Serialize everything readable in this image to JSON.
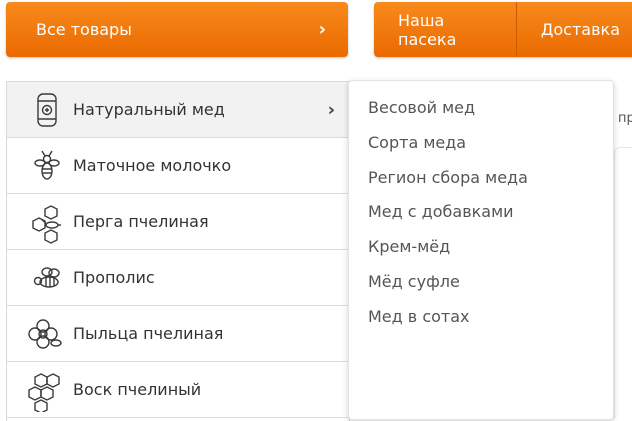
{
  "header": {
    "all_products_label": "Все товары",
    "all_products_chevron": "›",
    "nav": [
      {
        "label": "Наша пасека"
      },
      {
        "label": "Доставка"
      }
    ]
  },
  "categories": [
    {
      "label": "Натуральный мед",
      "icon": "honey-barrel-icon",
      "active": true,
      "has_submenu": true
    },
    {
      "label": "Маточное молочко",
      "icon": "bee-icon"
    },
    {
      "label": "Перга пчелиная",
      "icon": "honeycomb-bee-icon"
    },
    {
      "label": "Прополис",
      "icon": "flying-bee-icon"
    },
    {
      "label": "Пыльца пчелиная",
      "icon": "flower-pollen-icon"
    },
    {
      "label": "Воск пчелиный",
      "icon": "honeycomb-icon"
    }
  ],
  "category_arrow": "›",
  "submenu": {
    "items": [
      "Весовой мед",
      "Сорта меда",
      "Регион сбора меда",
      "Мед с добавками",
      "Крем-мёд",
      "Мёд суфле",
      "Мед в сотах"
    ]
  },
  "background": {
    "partial_text": "пр"
  },
  "colors": {
    "accent": "#f07a10",
    "active_row": "#f2f2f2"
  }
}
